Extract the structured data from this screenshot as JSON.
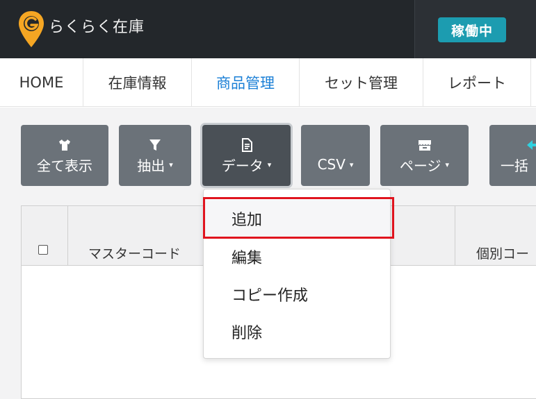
{
  "app": {
    "name": "らくらく在庫",
    "status": "稼働中",
    "logo_icon": "map-pin-g-logo",
    "brand_color": "#f5a623",
    "status_color": "#1c9cb0"
  },
  "nav": {
    "items": [
      {
        "label": "HOME"
      },
      {
        "label": "在庫情報"
      },
      {
        "label": "商品管理",
        "active": true
      },
      {
        "label": "セット管理"
      },
      {
        "label": "レポート"
      }
    ]
  },
  "toolbar": {
    "buttons": [
      {
        "label": "全て表示",
        "icon": "shirt-icon",
        "has_caret": false
      },
      {
        "label": "抽出",
        "icon": "filter-icon",
        "has_caret": true
      },
      {
        "label": "データ",
        "icon": "document-icon",
        "has_caret": true,
        "active": true
      },
      {
        "label": "CSV",
        "icon": "",
        "has_caret": true
      },
      {
        "label": "ページ",
        "icon": "store-icon",
        "has_caret": true
      },
      {
        "label": "一括",
        "icon": "arrow-icon",
        "has_caret": false
      }
    ],
    "caret": "▾"
  },
  "table": {
    "headers": [
      "マスターコード",
      "個別コー"
    ]
  },
  "dropdown": {
    "items": [
      "追加",
      "編集",
      "コピー作成",
      "削除"
    ],
    "highlighted_index": 0,
    "highlight_color": "#e0141e"
  }
}
